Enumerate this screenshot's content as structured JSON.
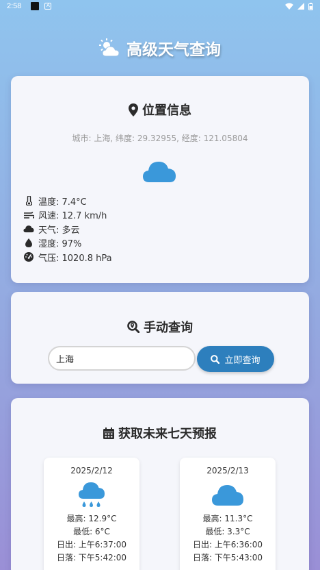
{
  "status_bar": {
    "time": "2:58",
    "app_badge": "A"
  },
  "app": {
    "title": "高级天气查询"
  },
  "location": {
    "heading": "位置信息",
    "subtitle": "城市: 上海, 纬度: 29.32955, 经度: 121.05804",
    "weather_icon": "cloud-icon",
    "details": [
      {
        "icon": "thermometer-icon",
        "text": "温度: 7.4°C"
      },
      {
        "icon": "wind-icon",
        "text": "风速: 12.7 km/h"
      },
      {
        "icon": "cloud-icon",
        "text": "天气: 多云"
      },
      {
        "icon": "droplet-icon",
        "text": "湿度: 97%"
      },
      {
        "icon": "gauge-icon",
        "text": "气压: 1020.8 hPa"
      }
    ]
  },
  "search": {
    "heading": "手动查询",
    "input_value": "上海",
    "button_label": "立即查询"
  },
  "forecast": {
    "heading": "获取未来七天预报",
    "days": [
      {
        "date": "2025/2/12",
        "icon": "cloud-rain-icon",
        "high": "最高: 12.9°C",
        "low": "最低: 6°C",
        "sunrise": "日出: 上午6:37:00",
        "sunset": "日落: 下午5:42:00"
      },
      {
        "date": "2025/2/13",
        "icon": "cloud-icon",
        "high": "最高: 11.3°C",
        "low": "最低: 3.3°C",
        "sunrise": "日出: 上午6:36:00",
        "sunset": "日落: 下午5:43:00"
      }
    ]
  },
  "colors": {
    "accent": "#2d7fbd",
    "icon_blue": "#3a98da"
  }
}
